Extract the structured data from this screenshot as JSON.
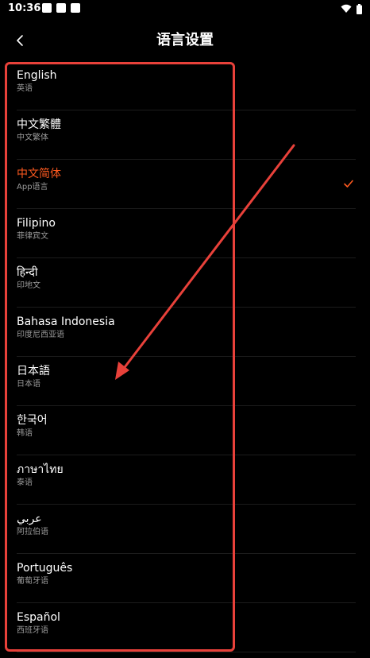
{
  "status_bar": {
    "time": "10:36",
    "icons": [
      "notification-icon",
      "notification-icon",
      "notification-icon",
      "wifi-icon",
      "battery-icon"
    ]
  },
  "header": {
    "title": "语言设置",
    "back_icon": "chevron-left-icon"
  },
  "languages": [
    {
      "name": "English",
      "sub": "英语",
      "selected": false
    },
    {
      "name": "中文繁體",
      "sub": "中文繁体",
      "selected": false
    },
    {
      "name": "中文简体",
      "sub": "App语言",
      "selected": true
    },
    {
      "name": "Filipino",
      "sub": "菲律宾文",
      "selected": false
    },
    {
      "name": "हिन्दी",
      "sub": "印地文",
      "selected": false
    },
    {
      "name": "Bahasa Indonesia",
      "sub": "印度尼西亚语",
      "selected": false
    },
    {
      "name": "日本語",
      "sub": "日本语",
      "selected": false
    },
    {
      "name": "한국어",
      "sub": "韩语",
      "selected": false
    },
    {
      "name": "ภาษาไทย",
      "sub": "泰语",
      "selected": false
    },
    {
      "name": "عربي",
      "sub": "阿拉伯语",
      "selected": false
    },
    {
      "name": "Português",
      "sub": "葡萄牙语",
      "selected": false
    },
    {
      "name": "Español",
      "sub": "西班牙语",
      "selected": false
    }
  ],
  "colors": {
    "background": "#000000",
    "accent": "#ff5a1f",
    "annotation": "#e8413a",
    "subtext": "#9a9a9a"
  }
}
